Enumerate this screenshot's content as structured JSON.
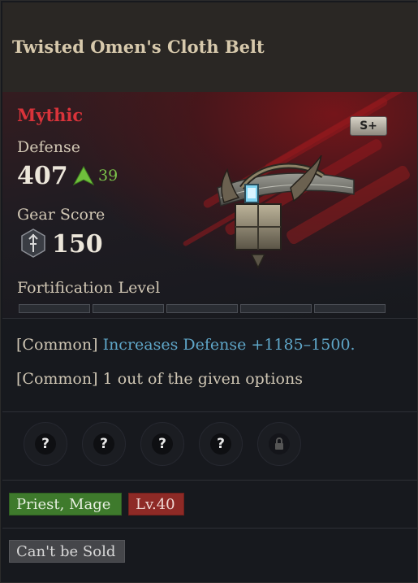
{
  "item": {
    "name": "Twisted Omen's Cloth Belt",
    "rarity": "Mythic",
    "grade": "S+",
    "defense_label": "Defense",
    "defense_value": "407",
    "defense_bonus": "39",
    "gear_score_label": "Gear Score",
    "gear_score_value": "150",
    "fortification_label": "Fortification Level",
    "fortification_filled": 0,
    "fortification_max": 5
  },
  "options": [
    {
      "tier": "[Common]",
      "text": "Increases Defense +1185–1500."
    },
    {
      "tier": "[Common]",
      "text": "1 out of the given options"
    }
  ],
  "sockets": [
    {
      "symbol": "?",
      "locked": false
    },
    {
      "symbol": "?",
      "locked": false
    },
    {
      "symbol": "?",
      "locked": false
    },
    {
      "symbol": "?",
      "locked": false
    },
    {
      "symbol": "",
      "locked": true
    }
  ],
  "tags": {
    "classes": "Priest, Mage",
    "level": "Lv.40",
    "sell": "Can't be Sold"
  },
  "colors": {
    "rarity": "#d9333a",
    "bonus_up": "#7bc24a",
    "option_highlight": "#5fa6c8",
    "class_tag": "#3e7a2c",
    "level_tag": "#8e2a26",
    "sell_tag": "#45464a"
  }
}
